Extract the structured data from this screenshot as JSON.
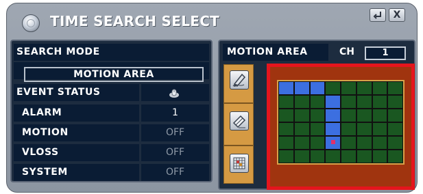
{
  "window": {
    "title": "TIME SEARCH SELECT",
    "buttons": {
      "enter_icon": "enter-arrow-icon",
      "close_label": "X"
    }
  },
  "left_panel": {
    "search_mode_label": "SEARCH MODE",
    "search_mode_value": "MOTION AREA",
    "event_status_label": "EVENT STATUS",
    "event_status_icon": "mouse-wheel-icon",
    "rows": [
      {
        "label": "ALARM",
        "value": "1"
      },
      {
        "label": "MOTION",
        "value": "OFF"
      },
      {
        "label": "VLOSS",
        "value": "OFF"
      },
      {
        "label": "SYSTEM",
        "value": "OFF"
      }
    ]
  },
  "right_panel": {
    "title": "MOTION AREA",
    "channel_label": "CH",
    "channel_value": "1",
    "tools": [
      "pencil-draw-icon",
      "eraser-icon",
      "grid-select-icon"
    ]
  },
  "colors": {
    "highlight": "#e5151d",
    "grid_selected": "#3c6fe0",
    "grid_active": "#2e8a33"
  }
}
